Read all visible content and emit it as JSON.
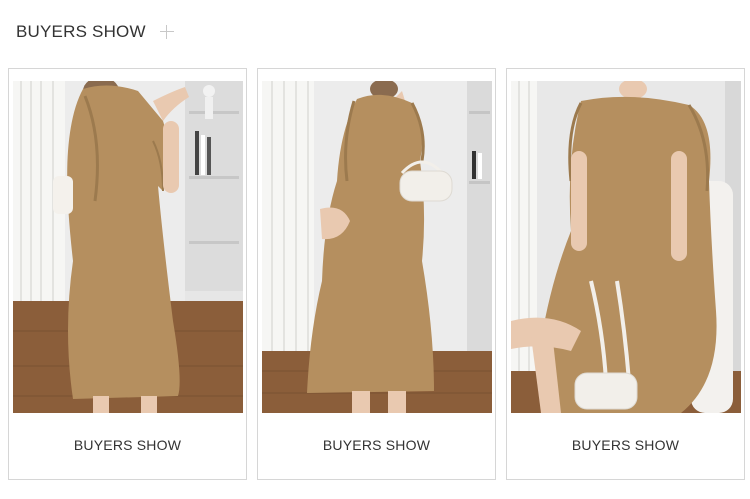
{
  "header": {
    "title": "BUYERS SHOW",
    "plus_icon": "plus-icon"
  },
  "cards": [
    {
      "caption": "BUYERS SHOW",
      "photo": "woman-in-khaki-dress-back-view"
    },
    {
      "caption": "BUYERS SHOW",
      "photo": "woman-in-khaki-dress-side-view-with-white-bag"
    },
    {
      "caption": "BUYERS SHOW",
      "photo": "woman-in-khaki-dress-seated-with-white-bag"
    }
  ],
  "colors": {
    "dress": "#b58f5f",
    "dress_shadow": "#9c7a4e",
    "floor": "#8b5e3a",
    "wall": "#ececec",
    "curtain": "#f6f6f4",
    "border": "#d6d6d6"
  }
}
